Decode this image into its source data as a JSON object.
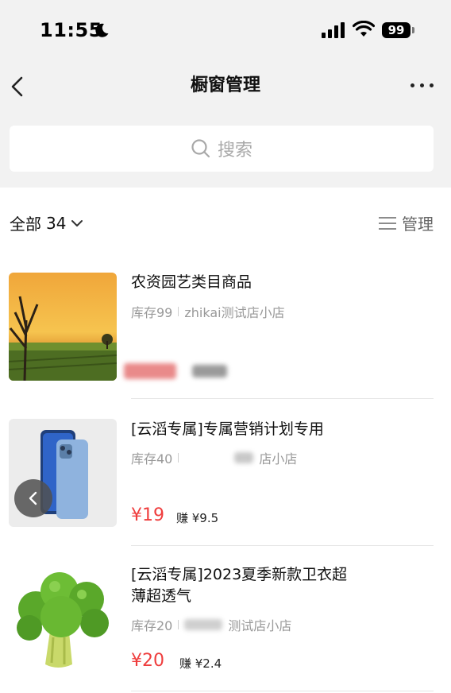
{
  "status_bar": {
    "time": "11:55",
    "battery": "99"
  },
  "nav": {
    "title": "橱窗管理"
  },
  "search": {
    "placeholder": "搜索"
  },
  "filter": {
    "label": "全部",
    "count": "34"
  },
  "manage": {
    "label": "管理"
  },
  "products": [
    {
      "name": "农资园艺类目商品",
      "stock": "库存99",
      "shop": "zhikai测试店小店",
      "price": "",
      "earn": ""
    },
    {
      "name": "[云滔专属]专属营销计划专用",
      "stock": "库存40",
      "shop": "店小店",
      "price": "¥19",
      "earn": "赚 ¥9.5"
    },
    {
      "name": "[云滔专属]2023夏季新款卫衣超薄超透气",
      "stock": "库存20",
      "shop": "测试店小店",
      "price": "¥20",
      "earn": "赚 ¥2.4"
    }
  ],
  "colors": {
    "price": "#ef3d3d",
    "background_top": "#f2f2f2"
  }
}
